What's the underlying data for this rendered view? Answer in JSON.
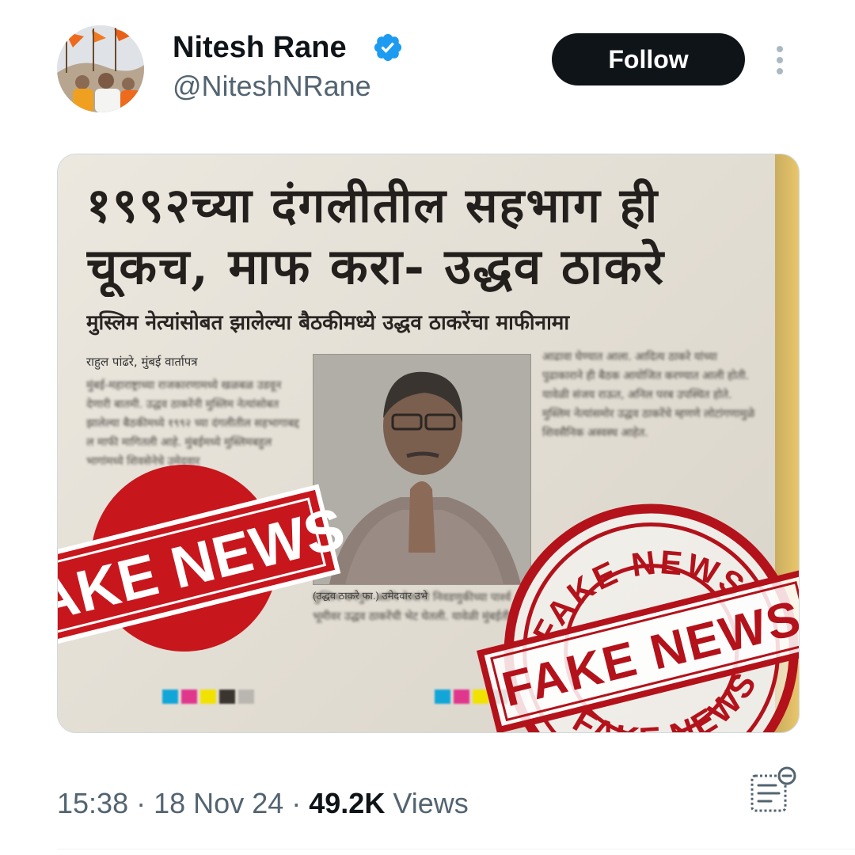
{
  "author": {
    "name": "Nitesh Rane",
    "handle": "@NiteshNRane",
    "verified": true,
    "avatar_icon": "crowd-photo-avatar"
  },
  "follow_label": "Follow",
  "more_icon": "vertical-ellipsis-icon",
  "media": {
    "headline_line1": "१९९२च्या दंगलीतील सहभाग ही",
    "headline_line2": "चूकच, माफ करा- उद्धव ठाकरे",
    "subhead": "मुस्लिम नेत्यांसोबत झालेल्या बैठकीमध्ये उद्धव ठाकरेंचा माफीनामा",
    "byline": "राहुल पांढरे, मुंबई वार्तापत्र",
    "photo_caption": "(उद्धव ठाकरे फा.) उमेदवार उभे",
    "column_left": "मुंबई-महाराष्ट्राच्या राजकारणामध्ये खळबळ उडवून देणारी बातमी. उद्धव ठाकरेंनी मुस्लिम नेत्यांसोबत झालेल्या बैठकीमध्ये १९९२ च्या दंगलीतील सहभागाबद्दल माफी मागितली आहे. मुंबईमध्ये मुस्लिमबहुल भागांमध्ये शिवसेनेचे उमेदवार",
    "column_right": "आढावा घेण्यात आला. आदित्य ठाकरे यांच्या पुढाकाराने ही बैठक आयोजित करण्यात आली होती. यावेळी संजय राऊत, अनिल परब उपस्थित होते. मुस्लिम नेत्यांसमोर उद्धव ठाकरेंचे म्हणणे लोटांगणामुळे शिवसैनिक अस्वस्थ आहेत.",
    "column_mid": "मुस्लिम धर्मगुरू आणि नेत्यांनी निवडणुकीच्या पार्श्वभूमीवर उद्धव ठाकरेंची भेट घेतली. यावेळी मुंबईतील",
    "stamp_text": "FAKE NEWS",
    "stamp_color": "#c8161d",
    "print_marks": [
      "#12a5d8",
      "#e0368c",
      "#f2e200",
      "#3b3530",
      "#b9b6b0"
    ]
  },
  "meta": {
    "time": "15:38",
    "date": "18 Nov 24",
    "separator": "·",
    "views_count": "49.2K",
    "views_label": "Views"
  },
  "notes_icon": "reader-notes-icon",
  "accent_color": "#1d9bf0"
}
